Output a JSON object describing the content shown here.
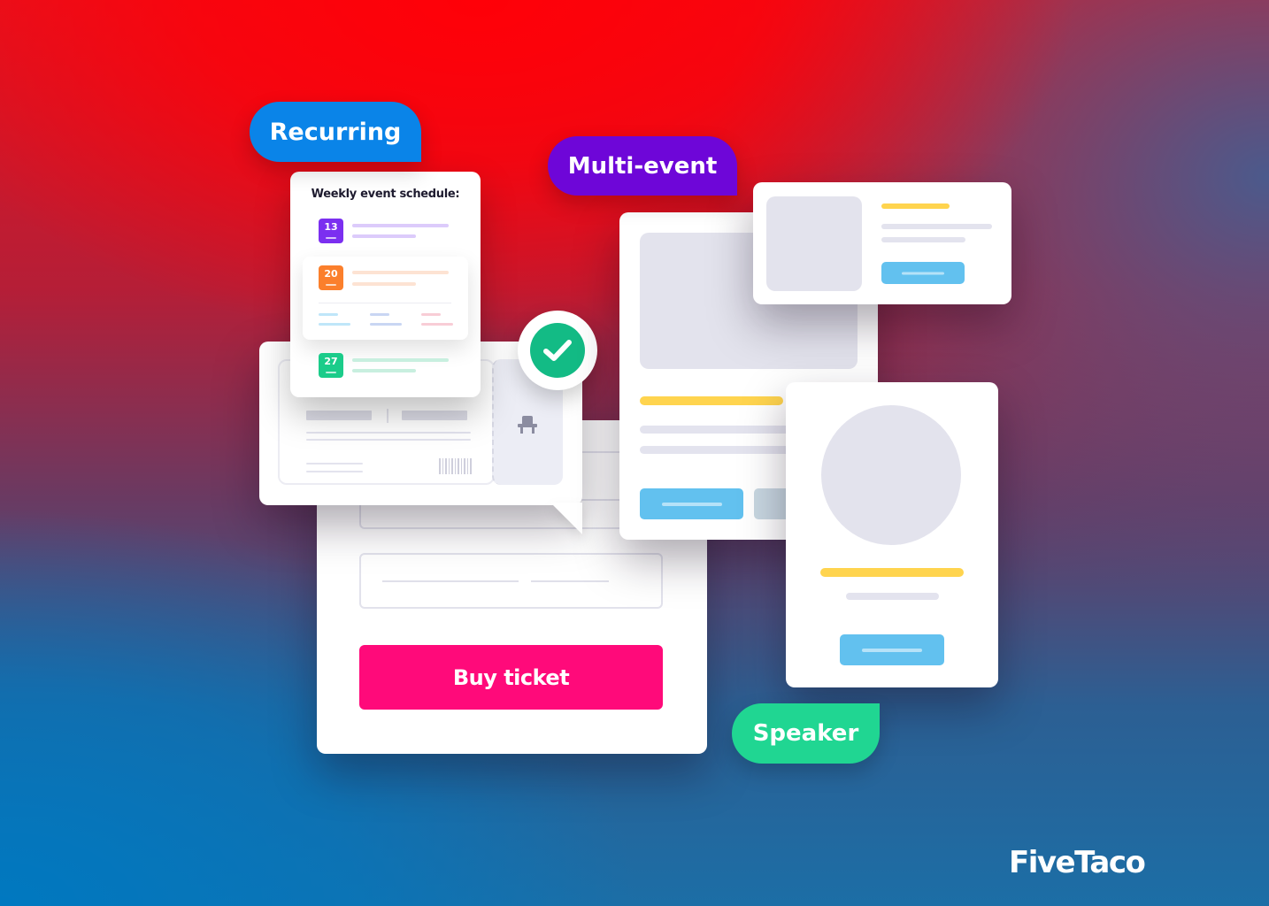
{
  "tags": {
    "recurring": {
      "label": "Recurring",
      "color": "#0a84e8"
    },
    "multi_event": {
      "label": "Multi-event",
      "color": "#6e06d8"
    },
    "speaker": {
      "label": "Speaker",
      "color": "#20d692"
    }
  },
  "schedule": {
    "title": "Weekly event schedule:",
    "days": [
      {
        "day": "13",
        "color": "#7b2ff0",
        "line_color": "#dccbfb"
      },
      {
        "day": "20",
        "color": "#fb7f2c",
        "line_color": "#fde3d3"
      },
      {
        "day": "27",
        "color": "#1bcc8a",
        "line_color": "#c8efdf"
      }
    ],
    "detail_line_colors": [
      "#bfe6f9",
      "#c9d6f3",
      "#f8cdd6"
    ]
  },
  "ticket": {
    "icon": "seat-icon",
    "status_icon": "check-icon",
    "status_color": "#13bb85"
  },
  "checkout": {
    "buy_label": "Buy ticket",
    "buy_color": "#ff0a7a"
  },
  "brand": {
    "logo": "FiveTaco"
  }
}
